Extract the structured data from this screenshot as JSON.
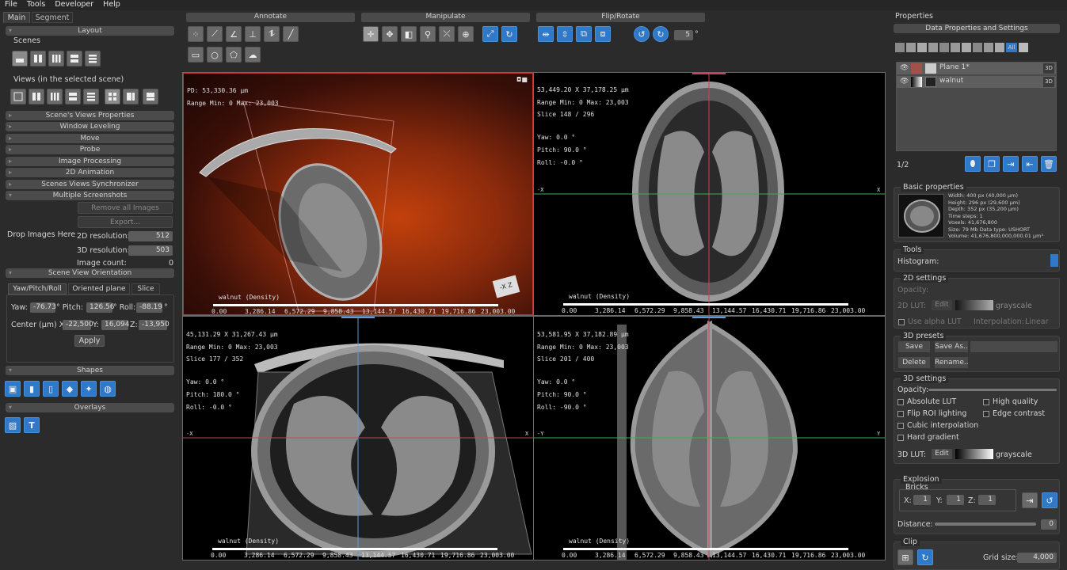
{
  "menu": [
    "File",
    "Tools",
    "Developer",
    "Help"
  ],
  "left": {
    "tabs": [
      "Main",
      "Segment"
    ],
    "layout_hdr": "Layout",
    "scenes_lbl": "Scenes",
    "views_lbl": "Views (in the selected scene)",
    "sections": [
      "Scene's Views Properties",
      "Window Leveling",
      "Move",
      "Probe",
      "Image Processing",
      "2D Animation",
      "Scenes Views Synchronizer",
      "Multiple Screenshots"
    ],
    "remove_all": "Remove all Images",
    "export": "Export...",
    "drop": "Drop Images Here",
    "res2d_lbl": "2D resolution:",
    "res2d": "512",
    "res3d_lbl": "3D resolution:",
    "res3d": "503",
    "count_lbl": "Image count:",
    "count": "0",
    "orient_hdr": "Scene View Orientation",
    "orient_tabs": [
      "Yaw/Pitch/Roll",
      "Oriented plane",
      "Slice"
    ],
    "yaw_lbl": "Yaw:",
    "yaw": "-76.73",
    "pitch_lbl": "° Pitch:",
    "pitch": "126.56",
    "roll_lbl": "° Roll:",
    "roll": "-88.19",
    "deg": "°",
    "center_lbl": "Center (µm) X:",
    "cx": "-22,500",
    "y_lbl": "Y:",
    "cy": "16,094",
    "z_lbl": "Z:",
    "cz": "-13,950",
    "apply": "Apply",
    "shapes_hdr": "Shapes",
    "overlays_hdr": "Overlays"
  },
  "toolbar": {
    "annotate": "Annotate",
    "manipulate": "Manipulate",
    "flip": "Flip/Rotate",
    "rot_val": "5",
    "deg": "°"
  },
  "views": {
    "v3d": {
      "l1": "PD: 53,330.36 µm",
      "l2": "Range Min: 0 Max: 23,003",
      "caption": "walnut (Density)"
    },
    "v1": {
      "l1": "53,449.20 X 37,178.25 µm",
      "l2": "Range Min: 0 Max: 23,003",
      "l3": "Slice 148 / 296",
      "yaw": "Yaw: 0.0 °",
      "pitch": "Pitch: 90.0 °",
      "roll": "Roll: -0.0 °",
      "caption": "walnut (Density)",
      "xl": "-X",
      "xr": "X"
    },
    "v2": {
      "l1": "45,131.29 X 31,267.43 µm",
      "l2": "Range Min: 0 Max: 23,003",
      "l3": "Slice 177 / 352",
      "yaw": "Yaw: 0.0 °",
      "pitch": "Pitch: 180.0 °",
      "roll": "Roll: -0.0 °",
      "caption": "walnut (Density)",
      "xl": "-X",
      "xr": "X"
    },
    "v3": {
      "l1": "53,581.95 X 37,182.89 µm",
      "l2": "Range Min: 0 Max: 23,003",
      "l3": "Slice 201 / 400",
      "yaw": "Yaw: 0.0 °",
      "pitch": "Pitch: 90.0 °",
      "roll": "Roll: -90.0 °",
      "caption": "walnut (Density)",
      "xl": "-Y",
      "xr": "Y"
    },
    "ticks": [
      "0.00",
      "3,286.14",
      "6,572.29",
      "9,858.43",
      "13,144.57",
      "16,430.71",
      "19,716.86",
      "23,003.00"
    ]
  },
  "right": {
    "title": "Properties",
    "dps_hdr": "Data Properties and Settings",
    "all": "All",
    "layers": [
      {
        "name": "Plane 1*",
        "tag": "3D"
      },
      {
        "name": "walnut",
        "tag": "3D"
      }
    ],
    "page": "1/2",
    "basic_hdr": "Basic properties",
    "basic_lines": [
      "Width: 400 px (40,000 µm)",
      "Height: 296 px (29,600 µm)",
      "Depth: 352 px (35,200 µm)",
      "Time steps: 1",
      "Voxels: 41,676,800",
      "Size: 79 Mb  Data type: USHORT",
      "Volume: 41,676,800,000,000.01 µm³"
    ],
    "tools_hdr": "Tools",
    "histogram": "Histogram:",
    "s2d_hdr": "2D settings",
    "opacity": "Opacity:",
    "lut2d": "2D LUT:",
    "edit": "Edit",
    "grayscale": "grayscale",
    "alpha_lut": "Use alpha LUT",
    "interp_lbl": "Interpolation:",
    "interp": "Linear",
    "presets_hdr": "3D presets",
    "save": "Save",
    "save_as": "Save As..",
    "delete": "Delete",
    "rename": "Rename..",
    "s3d_hdr": "3D settings",
    "opacity3": "Opacity:",
    "abs_lut": "Absolute LUT",
    "high_q": "High quality",
    "flip_roi": "Flip ROI lighting",
    "edge": "Edge contrast",
    "cubic": "Cubic interpolation",
    "hard": "Hard gradient",
    "lut3d": "3D LUT:",
    "explosion_hdr": "Explosion",
    "bricks": "Bricks",
    "bx": "X:",
    "by": "Y:",
    "bz": "Z:",
    "bval": "1",
    "distance": "Distance:",
    "dist_val": "0",
    "clip_hdr": "Clip",
    "grid_lbl": "Grid size:",
    "grid": "4,000"
  },
  "colors": {
    "accent": "#2f79c8",
    "red_line": "#c8445a",
    "green_line": "#3fae5b",
    "blue_line": "#5d9de0"
  }
}
